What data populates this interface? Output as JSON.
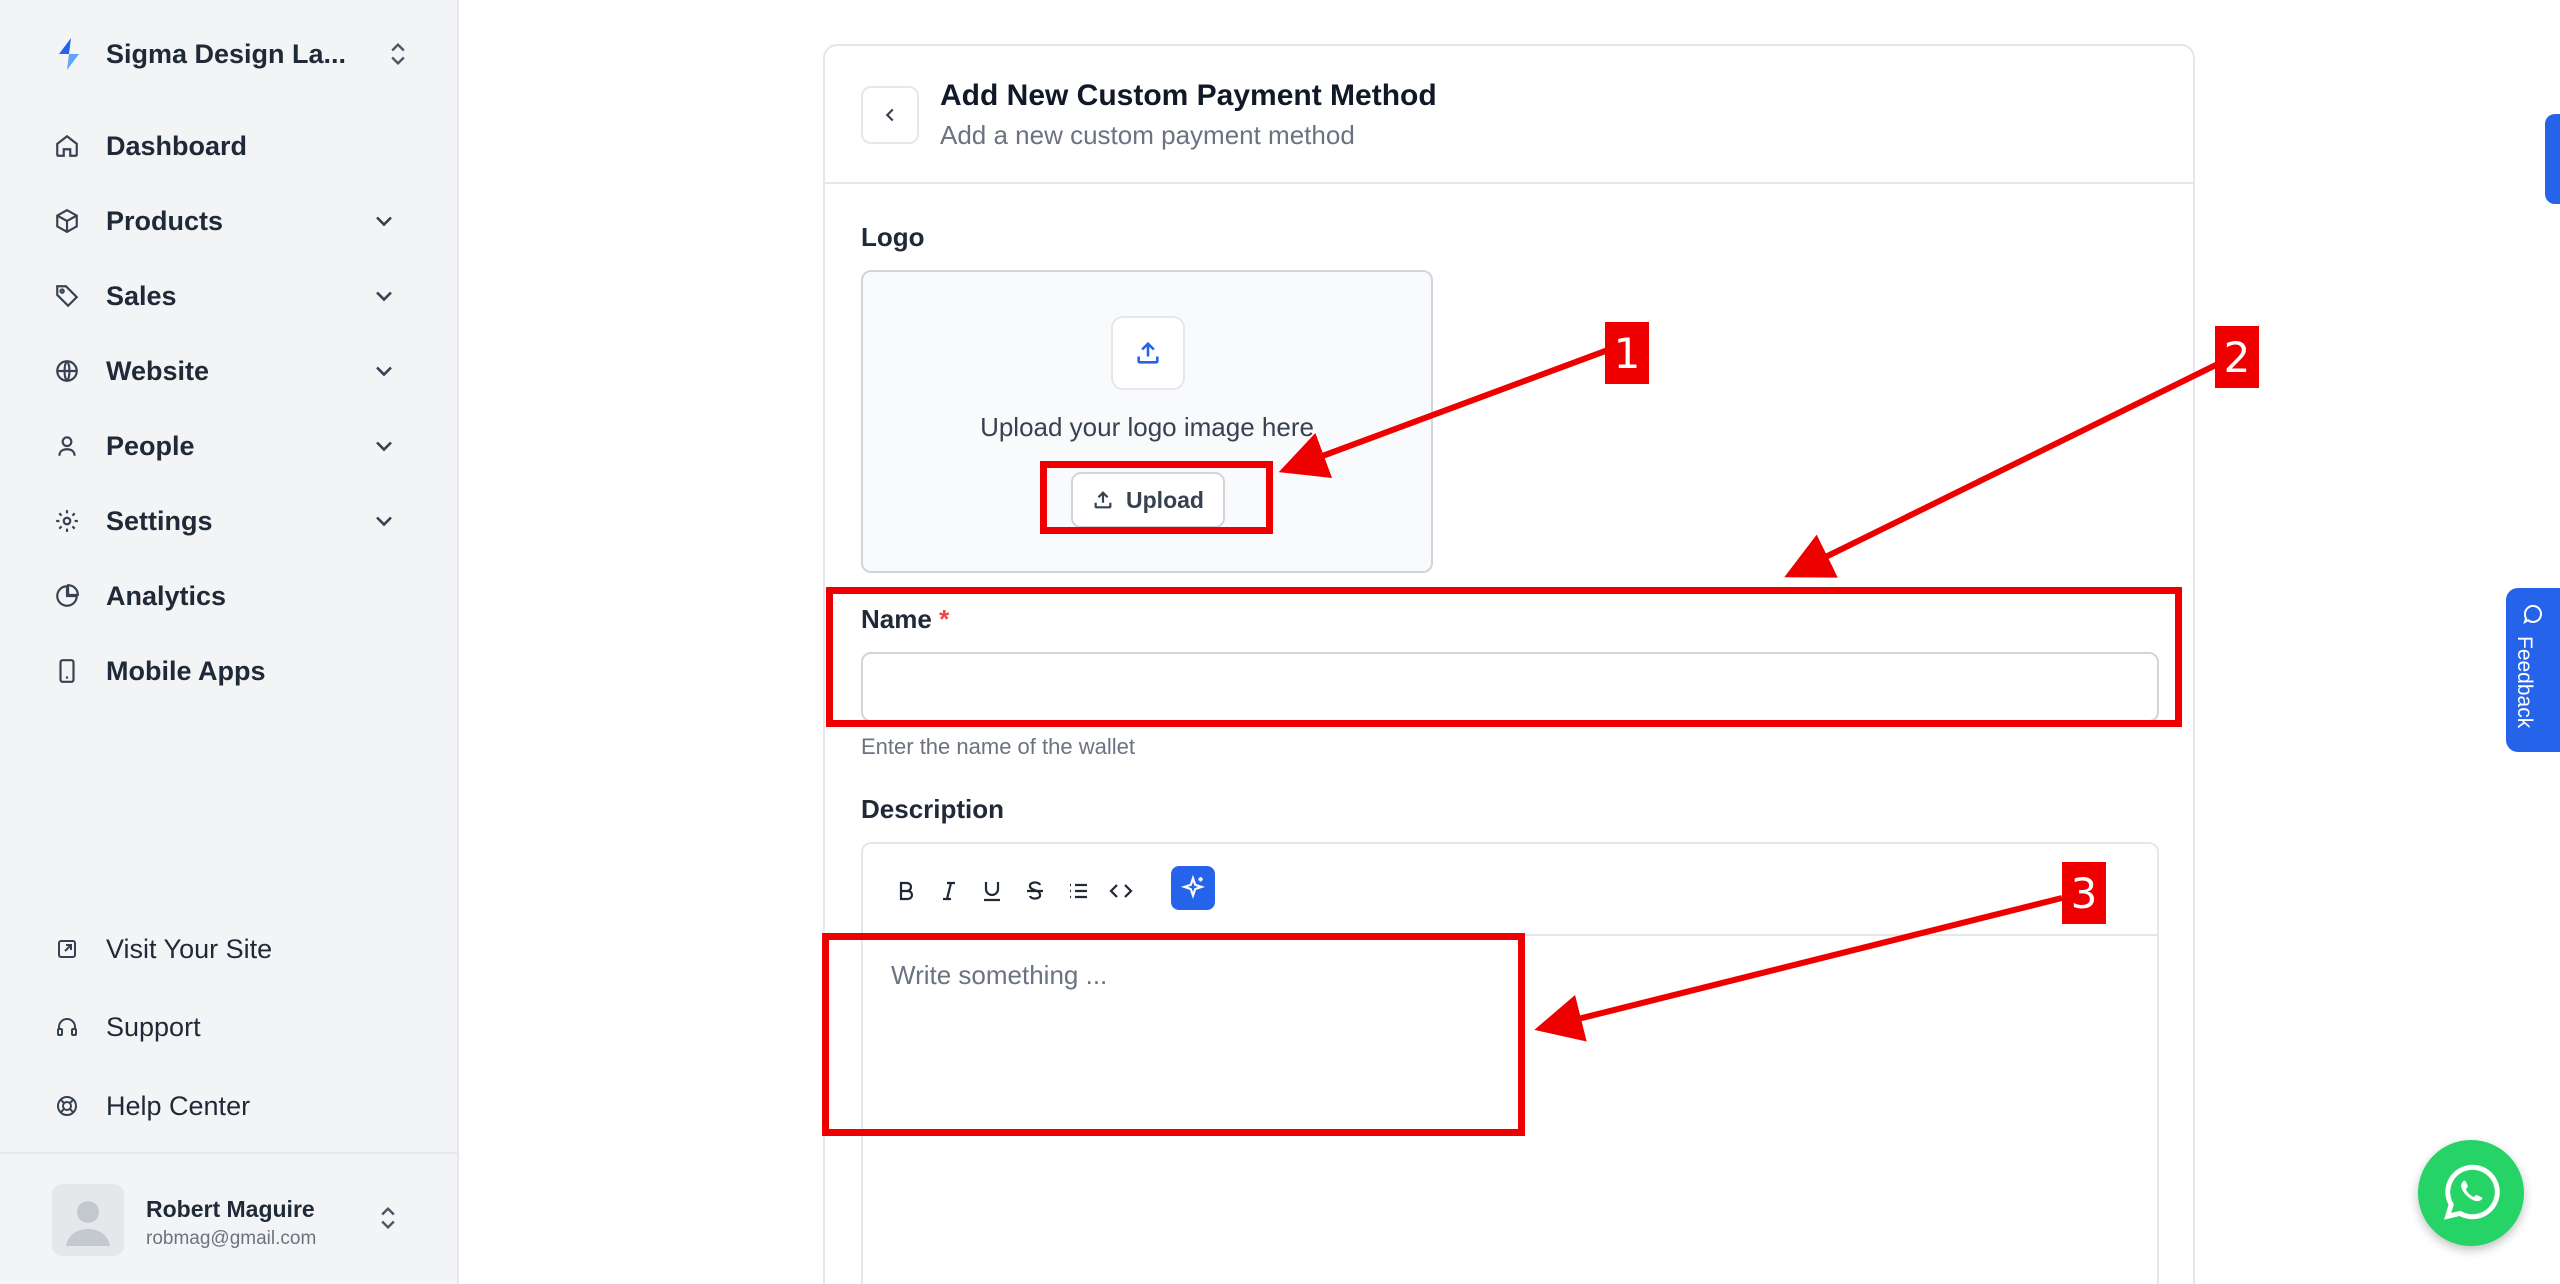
{
  "sidebar": {
    "brand": {
      "name": "Sigma Design La...",
      "logo": "brand-logo-icon"
    },
    "nav": [
      {
        "label": "Dashboard",
        "icon": "home-icon",
        "expandable": false
      },
      {
        "label": "Products",
        "icon": "box-icon",
        "expandable": true
      },
      {
        "label": "Sales",
        "icon": "tag-icon",
        "expandable": true
      },
      {
        "label": "Website",
        "icon": "globe-icon",
        "expandable": true
      },
      {
        "label": "People",
        "icon": "user-icon",
        "expandable": true
      },
      {
        "label": "Settings",
        "icon": "gear-icon",
        "expandable": true
      },
      {
        "label": "Analytics",
        "icon": "pie-chart-icon",
        "expandable": false
      },
      {
        "label": "Mobile Apps",
        "icon": "mobile-icon",
        "expandable": false
      }
    ],
    "footer": [
      {
        "label": "Visit Your Site",
        "icon": "external-link-icon"
      },
      {
        "label": "Support",
        "icon": "headset-icon"
      },
      {
        "label": "Help Center",
        "icon": "lifebuoy-icon"
      }
    ],
    "user": {
      "name": "Robert Maguire",
      "email": "robmag@gmail.com"
    }
  },
  "form": {
    "title": "Add New Custom Payment Method",
    "subtitle": "Add a new custom payment method",
    "logo_label": "Logo",
    "upload_text": "Upload your logo image here",
    "upload_button": "Upload",
    "name_label": "Name",
    "required_mark": "*",
    "name_value": "",
    "name_helper": "Enter the name of the wallet",
    "description_label": "Description",
    "editor_placeholder": "Write something ...",
    "toolbar": [
      "bold-icon",
      "italic-icon",
      "underline-icon",
      "strikethrough-icon",
      "list-icon",
      "code-icon",
      "ai-sparkle-icon"
    ]
  },
  "widgets": {
    "feedback_label": "Feedback"
  },
  "annotations": [
    {
      "number": "1"
    },
    {
      "number": "2"
    },
    {
      "number": "3"
    }
  ],
  "colors": {
    "accent": "#2563eb",
    "annotation": "#ef0000",
    "whatsapp": "#25d366",
    "sidebar_bg": "#f3f4f6"
  }
}
